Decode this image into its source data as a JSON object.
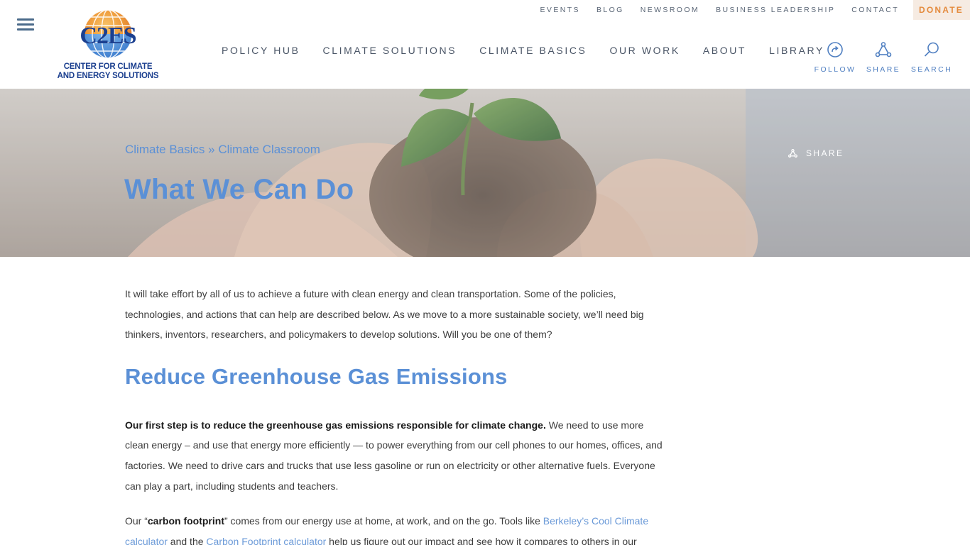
{
  "header": {
    "logo": {
      "abbr": "C2ES",
      "line1": "CENTER FOR CLIMATE",
      "line2": "AND ENERGY SOLUTIONS"
    },
    "top_links": [
      "EVENTS",
      "BLOG",
      "NEWSROOM",
      "BUSINESS LEADERSHIP",
      "CONTACT"
    ],
    "donate": "DONATE",
    "nav": [
      "POLICY HUB",
      "CLIMATE SOLUTIONS",
      "CLIMATE BASICS",
      "OUR WORK",
      "ABOUT",
      "LIBRARY"
    ],
    "tools": {
      "follow": "FOLLOW",
      "share": "SHARE",
      "search": "SEARCH"
    }
  },
  "hero": {
    "breadcrumb": {
      "parent": "Climate Basics",
      "separator": " » ",
      "current": "Climate Classroom"
    },
    "title": "What We Can Do",
    "share": "SHARE"
  },
  "content": {
    "intro": "It will take effort by all of us to achieve a future with clean energy and clean transportation. Some of the policies, technologies, and actions that can help are described below. As we move to a more sustainable society, we’ll need big thinkers, inventors, researchers, and policymakers to develop solutions. Will you be one of them?",
    "heading": "Reduce Greenhouse Gas Emissions",
    "para1_bold": "Our first step is to reduce the greenhouse gas emissions responsible for climate change.",
    "para1_rest": " We need to use more clean energy – and use that energy more efficiently — to power everything from our cell phones to our homes, offices, and factories. We need to drive cars and trucks that use less gasoline or run on electricity or other alternative fuels. Everyone can play a part, including students and teachers.",
    "para2_start": "Our “",
    "para2_bold": "carbon footprint",
    "para2_mid": "” comes from our energy use at home, at work, and on the go. Tools like ",
    "link1": "Berkeley’s Cool Climate calculator",
    "para2_and": " and the ",
    "link2": "Carbon Footprint calculator",
    "para2_end": " help us figure out our impact and see how it compares to others in our"
  },
  "colors": {
    "accent_blue": "#5b90d6",
    "donate_orange": "#e48a3c",
    "donate_bg": "#f6ebe2",
    "nav_text": "#4a5566"
  },
  "icons": [
    "menu-icon",
    "globe-logo-icon",
    "follow-icon",
    "share-icon",
    "search-icon"
  ]
}
